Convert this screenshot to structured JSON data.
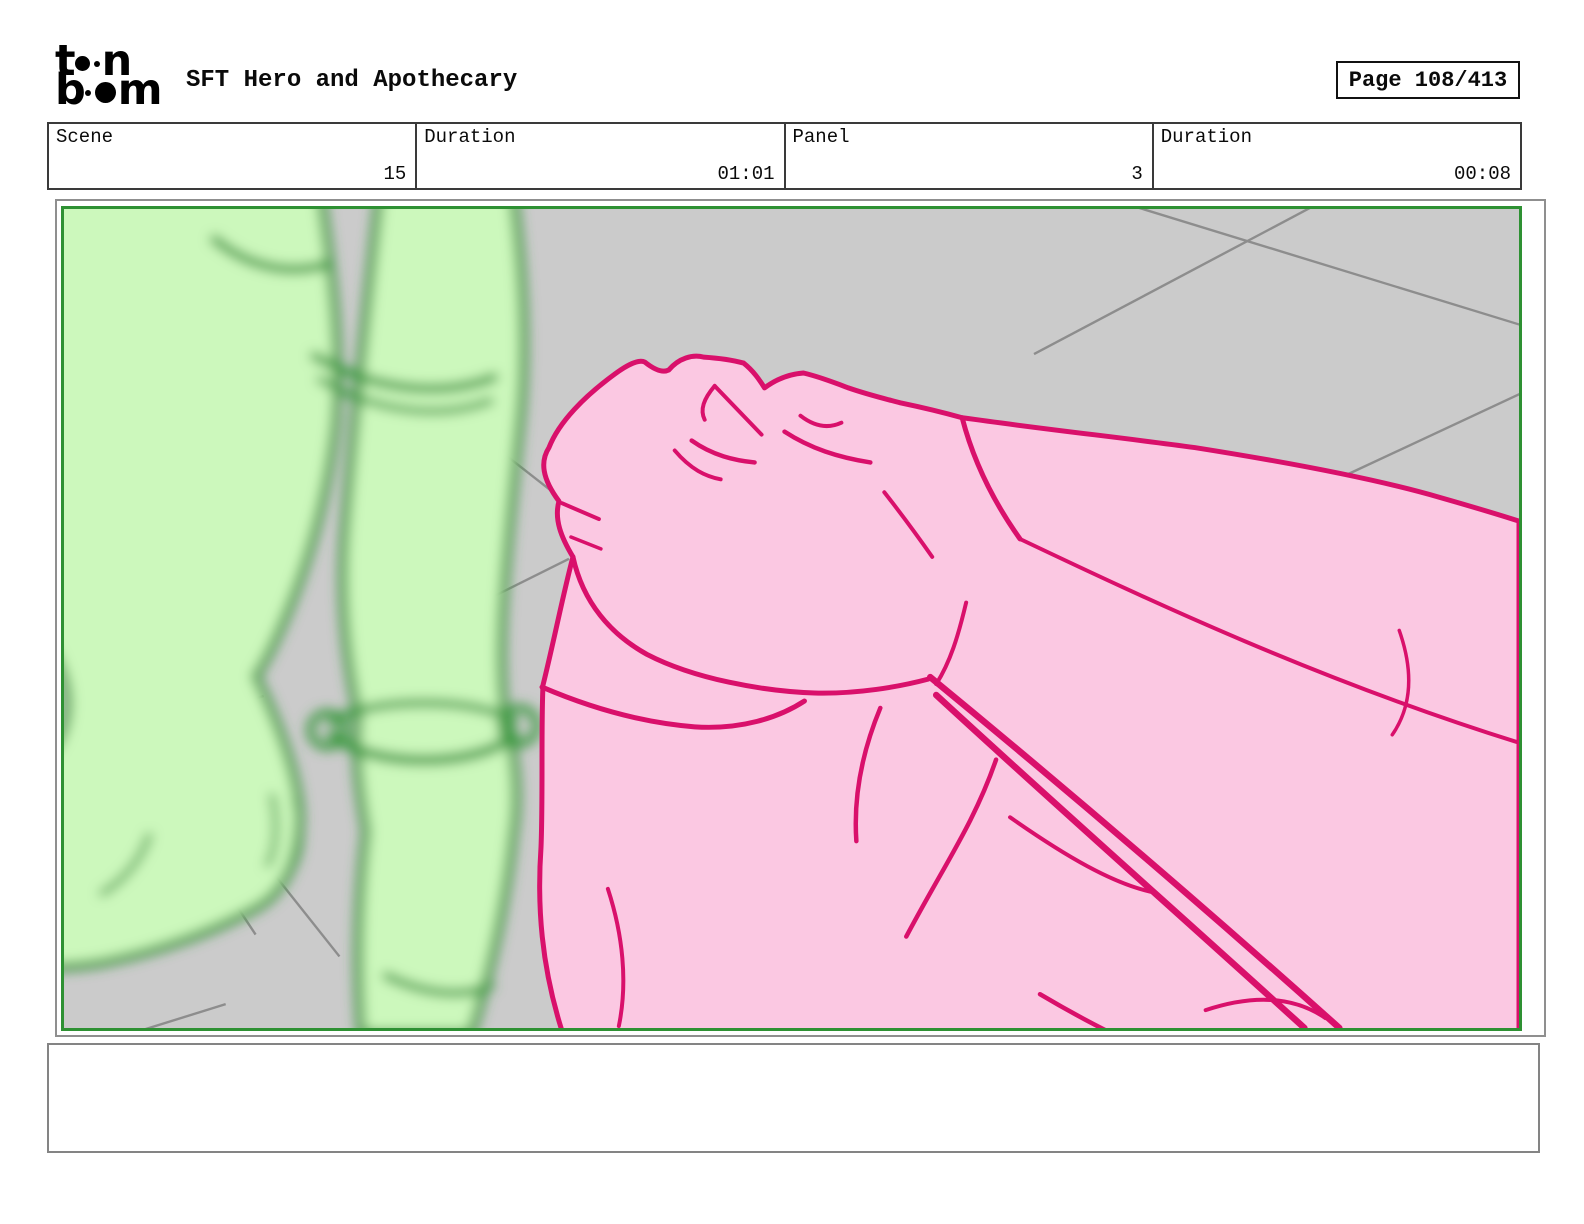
{
  "header": {
    "logo": {
      "brand": "toon boom",
      "line1_start": "t",
      "line1_end": "n",
      "line2_start": "b",
      "line2_end": "m"
    },
    "title": "SFT Hero and Apothecary",
    "page_label": "Page 108/413"
  },
  "info_table": {
    "cells": [
      {
        "label": "Scene",
        "value": "15"
      },
      {
        "label": "Duration",
        "value": "01:01"
      },
      {
        "label": "Panel",
        "value": "3"
      },
      {
        "label": "Duration",
        "value": "00:08"
      }
    ]
  },
  "panel": {
    "description": "storyboard drawing: blurred green character legs at left, in-focus pink fist, arm and knee holding a staff at right, gray floor with perspective lines",
    "camera_frame_color": "#2e9133",
    "background_color": "#cbcbcb",
    "floor_line_color": "#8d8d8d",
    "green_fill": "#ccf8bc",
    "green_line": "#3e9a42",
    "pink_fill": "#fbc8e2",
    "pink_line": "#d9106b"
  },
  "caption": {
    "text": ""
  }
}
